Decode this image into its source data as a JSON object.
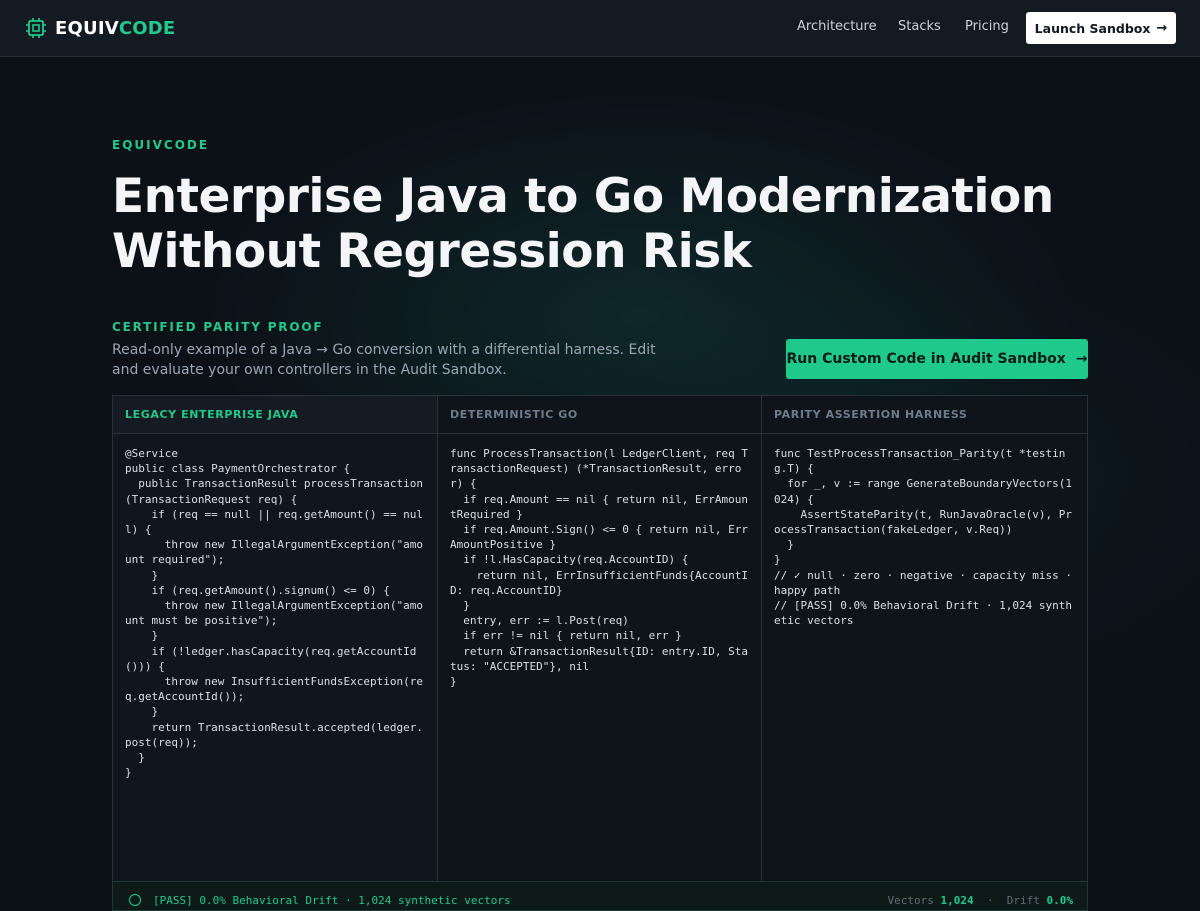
{
  "nav": {
    "brand_primary": "EQUIV",
    "brand_accent": "CODE",
    "links": [
      "Architecture",
      "Stacks",
      "Pricing"
    ],
    "launch_label": "Launch Sandbox"
  },
  "hero": {
    "eyebrow": "EQUIVCODE",
    "headline_line1": "Enterprise Java to Go Modernization",
    "headline_line2": "Without Regression Risk"
  },
  "proof": {
    "label": "CERTIFIED PARITY PROOF",
    "description": "Read-only example of a Java → Go conversion with a differential harness. Edit and evaluate your own controllers in the Audit Sandbox.",
    "cta_label": "Run Custom Code in Audit Sandbox"
  },
  "panels": [
    {
      "title": "LEGACY ENTERPRISE JAVA",
      "code": "@Service\npublic class PaymentOrchestrator {\n  public TransactionResult processTransaction(TransactionRequest req) {\n    if (req == null || req.getAmount() == null) {\n      throw new IllegalArgumentException(\"amount required\");\n    }\n    if (req.getAmount().signum() <= 0) {\n      throw new IllegalArgumentException(\"amount must be positive\");\n    }\n    if (!ledger.hasCapacity(req.getAccountId())) {\n      throw new InsufficientFundsException(req.getAccountId());\n    }\n    return TransactionResult.accepted(ledger.post(req));\n  }\n}"
    },
    {
      "title": "DETERMINISTIC GO",
      "code": "func ProcessTransaction(l LedgerClient, req TransactionRequest) (*TransactionResult, error) {\n  if req.Amount == nil { return nil, ErrAmountRequired }\n  if req.Amount.Sign() <= 0 { return nil, ErrAmountPositive }\n  if !l.HasCapacity(req.AccountID) {\n    return nil, ErrInsufficientFunds{AccountID: req.AccountID}\n  }\n  entry, err := l.Post(req)\n  if err != nil { return nil, err }\n  return &TransactionResult{ID: entry.ID, Status: \"ACCEPTED\"}, nil\n}"
    },
    {
      "title": "PARITY ASSERTION HARNESS",
      "code": "func TestProcessTransaction_Parity(t *testing.T) {\n  for _, v := range GenerateBoundaryVectors(1024) {\n    AssertStateParity(t, RunJavaOracle(v), ProcessTransaction(fakeLedger, v.Req))\n  }\n}\n// ✓ null · zero · negative · capacity miss · happy path\n// [PASS] 0.0% Behavioral Drift · 1,024 synthetic vectors"
    }
  ],
  "status": {
    "text": "[PASS] 0.0% Behavioral Drift · 1,024 synthetic vectors",
    "vectors_label": "Vectors",
    "vectors_value": "1,024",
    "drift_label": "Drift",
    "drift_value": "0.0%"
  }
}
